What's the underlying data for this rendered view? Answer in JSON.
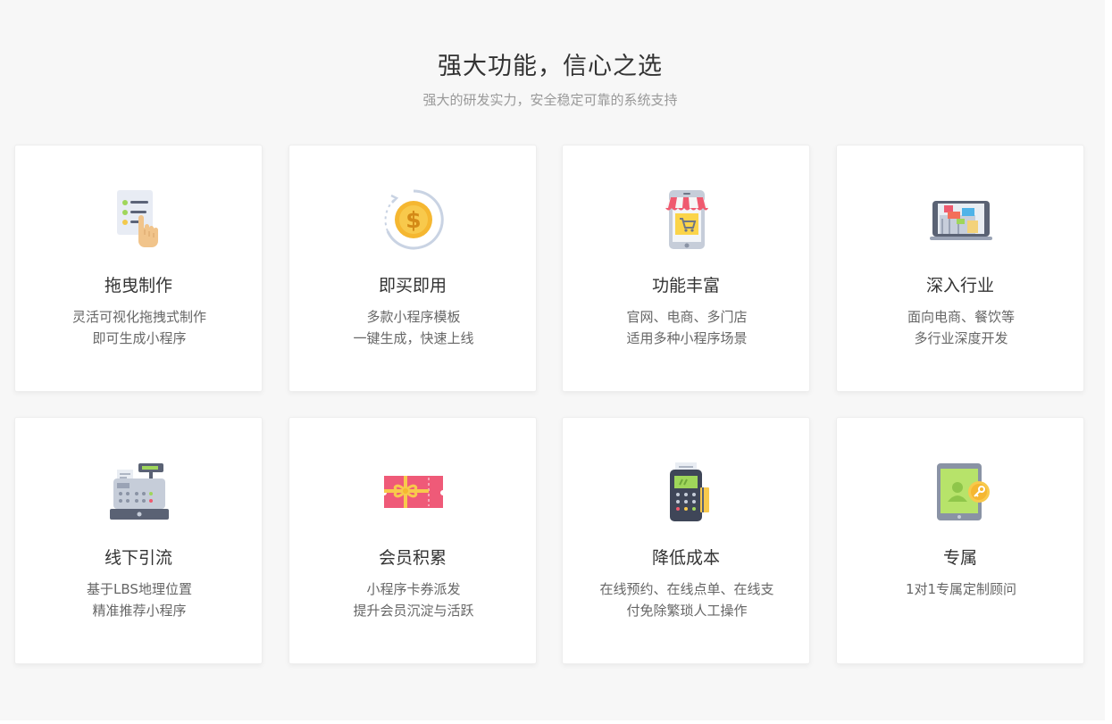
{
  "section": {
    "title": "强大功能，信心之选",
    "subtitle": "强大的研发实力，安全稳定可靠的系统支持"
  },
  "features": [
    {
      "title": "拖曳制作",
      "lines": [
        "灵活可视化拖拽式制作",
        "即可生成小程序"
      ],
      "icon": "drag-document-icon"
    },
    {
      "title": "即买即用",
      "lines": [
        "多款小程序模板",
        "一键生成，快速上线"
      ],
      "icon": "dollar-coin-icon"
    },
    {
      "title": "功能丰富",
      "lines": [
        "官网、电商、多门店",
        "适用多种小程序场景"
      ],
      "icon": "phone-shop-icon"
    },
    {
      "title": "深入行业",
      "lines": [
        "面向电商、餐饮等",
        "多行业深度开发"
      ],
      "icon": "tablet-industry-icon"
    },
    {
      "title": "线下引流",
      "lines": [
        "基于LBS地理位置",
        "精准推荐小程序"
      ],
      "icon": "cash-register-icon"
    },
    {
      "title": "会员积累",
      "lines": [
        "小程序卡券派发",
        "提升会员沉淀与活跃"
      ],
      "icon": "gift-coupon-icon"
    },
    {
      "title": "降低成本",
      "lines": [
        "在线预约、在线点单、在线支",
        "付免除繁琐人工操作"
      ],
      "icon": "pos-terminal-icon"
    },
    {
      "title": "专属",
      "lines": [
        "1对1专属定制顾问"
      ],
      "icon": "tablet-key-icon"
    }
  ]
}
